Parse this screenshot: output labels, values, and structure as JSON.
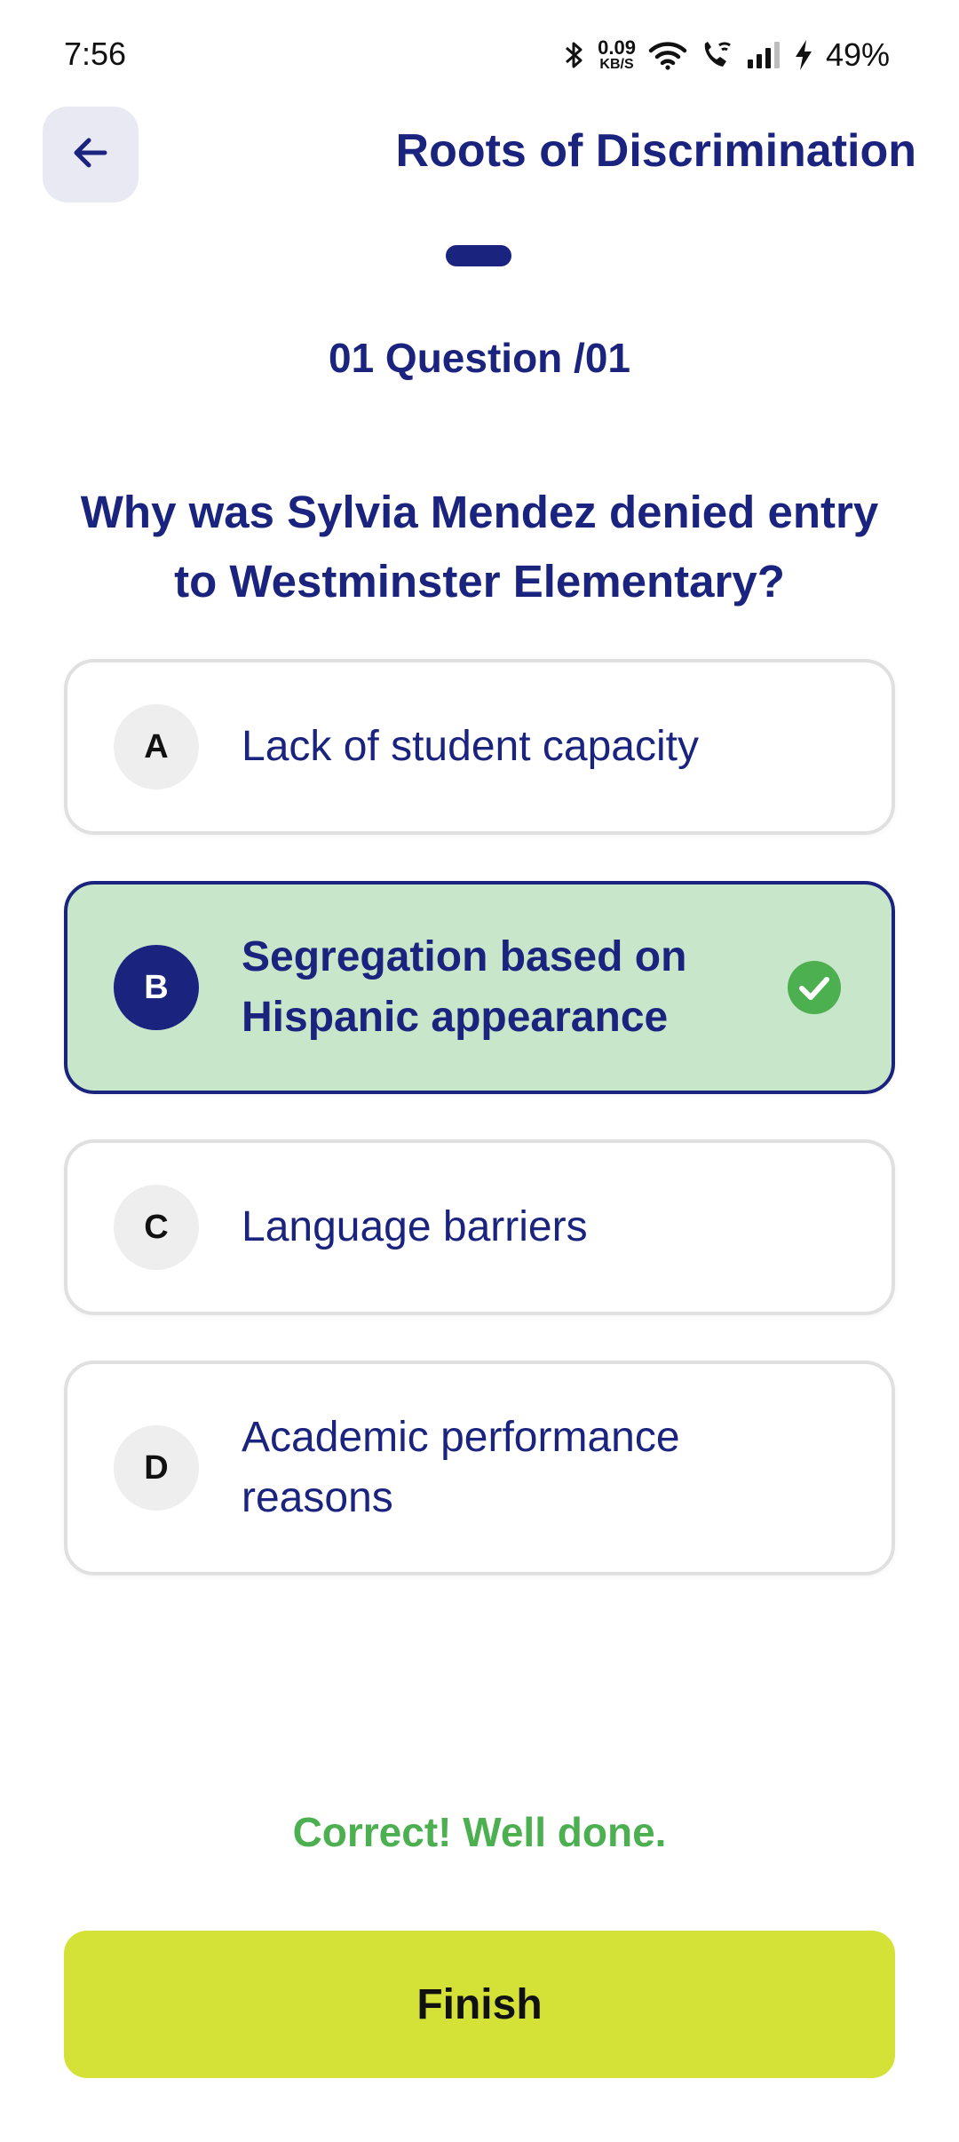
{
  "status_bar": {
    "time": "7:56",
    "net_speed_value": "0.09",
    "net_speed_unit": "KB/S",
    "battery_percent": "49%",
    "icons": [
      "bluetooth-icon",
      "wifi-icon",
      "wifi-call-icon",
      "signal-icon",
      "charging-icon"
    ]
  },
  "header": {
    "back_icon": "arrow-left-icon",
    "title": "Roots of Discrimination"
  },
  "quiz": {
    "counter": "01 Question /01",
    "question": "Why was Sylvia Mendez denied entry to Westminster Elementary?",
    "options": [
      {
        "letter": "A",
        "text": "Lack of student capacity",
        "selected": false
      },
      {
        "letter": "B",
        "text": "Segregation based on Hispanic appearance",
        "selected": true,
        "correct": true
      },
      {
        "letter": "C",
        "text": "Language barriers",
        "selected": false
      },
      {
        "letter": "D",
        "text": "Academic performance reasons",
        "selected": false
      }
    ],
    "feedback": "Correct! Well done."
  },
  "actions": {
    "finish_label": "Finish"
  },
  "colors": {
    "primary": "#1a237e",
    "selected_bg": "#c8e6c9",
    "success": "#4caf50",
    "finish_bg": "#d4e238"
  }
}
